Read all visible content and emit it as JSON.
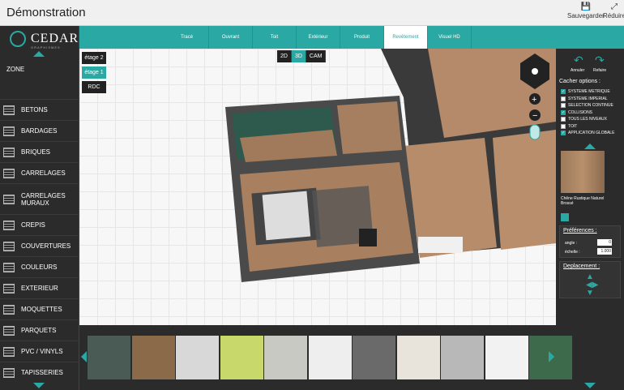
{
  "titlebar": {
    "title": "Démonstration",
    "save_label": "Sauvegarder",
    "reduce_label": "Réduire"
  },
  "logo": {
    "name": "CEDAR",
    "sub": "GRAPHISMES"
  },
  "sidebar": {
    "zone": "ZONE",
    "items": [
      {
        "label": "BETONS"
      },
      {
        "label": "BARDAGES"
      },
      {
        "label": "BRIQUES"
      },
      {
        "label": "CARRELAGES"
      },
      {
        "label": "CARRELAGES MURAUX"
      },
      {
        "label": "CREPIS"
      },
      {
        "label": "COUVERTURES"
      },
      {
        "label": "COULEURS"
      },
      {
        "label": "EXTERIEUR"
      },
      {
        "label": "MOQUETTES"
      },
      {
        "label": "PARQUETS"
      },
      {
        "label": "PVC / VINYLS"
      },
      {
        "label": "TAPISSERIES"
      }
    ]
  },
  "tabs": [
    {
      "label": "Tracé"
    },
    {
      "label": "Ouvrant"
    },
    {
      "label": "Toit"
    },
    {
      "label": "Extérieur"
    },
    {
      "label": "Produit"
    },
    {
      "label": "Revêtement",
      "active": true
    },
    {
      "label": "Visuel HD"
    }
  ],
  "floors": [
    {
      "label": "étage 2"
    },
    {
      "label": "étage 1",
      "active": true
    },
    {
      "label": "RDC"
    }
  ],
  "views": [
    {
      "label": "2D"
    },
    {
      "label": "3D",
      "active": true
    },
    {
      "label": "CAM"
    }
  ],
  "right": {
    "undo": "Annuler",
    "redo": "Refaire",
    "options_title": "Cacher options :",
    "options": [
      {
        "label": "SYSTEME METRIQUE",
        "checked": true
      },
      {
        "label": "SYSTEME IMPERIAL",
        "checked": false
      },
      {
        "label": "SELECTION CONTINUE",
        "checked": false
      },
      {
        "label": "COLLISIONS",
        "checked": true
      },
      {
        "label": "TOUS LES NIVEAUX",
        "checked": false
      },
      {
        "label": "TOIT",
        "checked": false
      },
      {
        "label": "APPLICATION GLOBALE",
        "checked": true
      }
    ],
    "texture_name": "Chêne Rustique Naturel Brossé",
    "prefs_title": "Préférences :",
    "angle_label": "angle :",
    "angle_value": "0",
    "scale_label": "échelle :",
    "scale_value": "1.000",
    "move_title": "Deplacement :"
  },
  "colors": {
    "accent": "#2aa8a3",
    "dark": "#2b2b2b"
  },
  "swatches": [
    {
      "name": "dark-foliage",
      "color": "#4a5a55"
    },
    {
      "name": "wood-planks",
      "color": "#8a6a48"
    },
    {
      "name": "grey-floral",
      "color": "#d8d8d8"
    },
    {
      "name": "lime-pattern",
      "color": "#c8d86a"
    },
    {
      "name": "bird-branches",
      "color": "#c9c9c4"
    },
    {
      "name": "hexagon-white",
      "color": "#eeeeee"
    },
    {
      "name": "geometric-bw",
      "color": "#6a6a6a"
    },
    {
      "name": "birch-trees",
      "color": "#e8e4dc"
    },
    {
      "name": "triangles",
      "color": "#b8b8b8"
    },
    {
      "name": "white-waves",
      "color": "#f2f2f2"
    },
    {
      "name": "palm-leaves",
      "color": "#3d6a4a"
    }
  ]
}
